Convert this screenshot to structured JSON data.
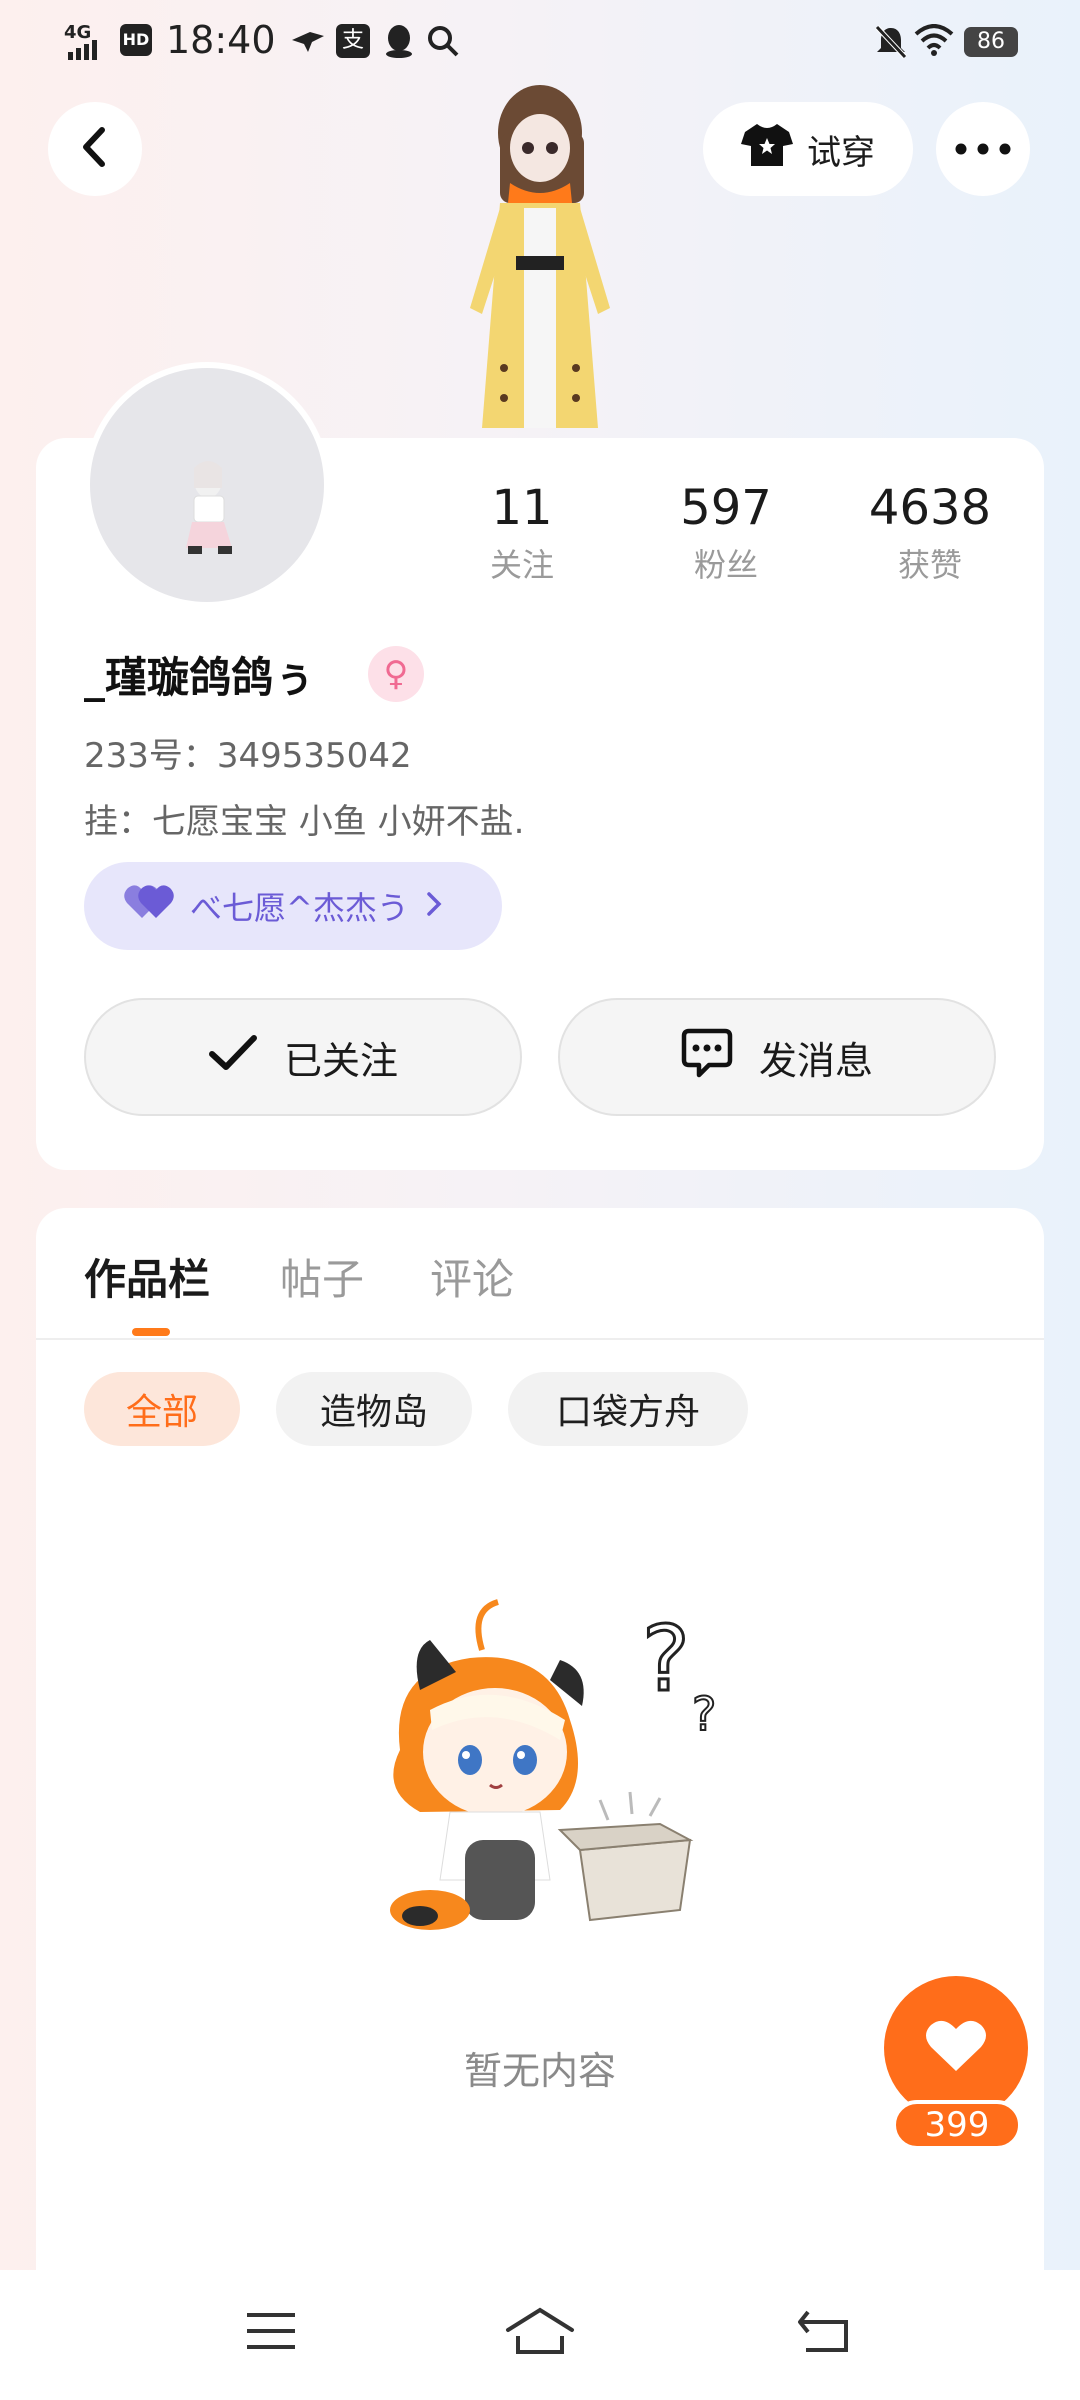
{
  "status_bar": {
    "network": "4G",
    "hd": "HD",
    "time": "18:40",
    "battery": "86"
  },
  "header": {
    "try_on_label": "试穿"
  },
  "profile": {
    "stats": [
      {
        "value": "11",
        "label": "关注"
      },
      {
        "value": "597",
        "label": "粉丝"
      },
      {
        "value": "4638",
        "label": "获赞"
      }
    ],
    "name": "_瑾璇鸽鸽ぅ",
    "uid": "233号：349535042",
    "bio": "挂：七愿宝宝  小鱼 小妍不盐.",
    "couple_tag": "べ七愿^杰杰う",
    "follow_button": "已关注",
    "message_button": "发消息"
  },
  "content": {
    "tabs": [
      {
        "label": "作品栏",
        "active": true
      },
      {
        "label": "帖子",
        "active": false
      },
      {
        "label": "评论",
        "active": false
      }
    ],
    "filters": [
      {
        "label": "全部",
        "active": true
      },
      {
        "label": "造物岛",
        "active": false
      },
      {
        "label": "口袋方舟",
        "active": false
      }
    ],
    "empty_text": "暂无内容"
  },
  "like_fab": {
    "count": "399"
  },
  "colors": {
    "accent": "#ff6d1a",
    "couple_tag_bg": "#e7e6fb",
    "couple_tag_fg": "#6b5bd6"
  }
}
